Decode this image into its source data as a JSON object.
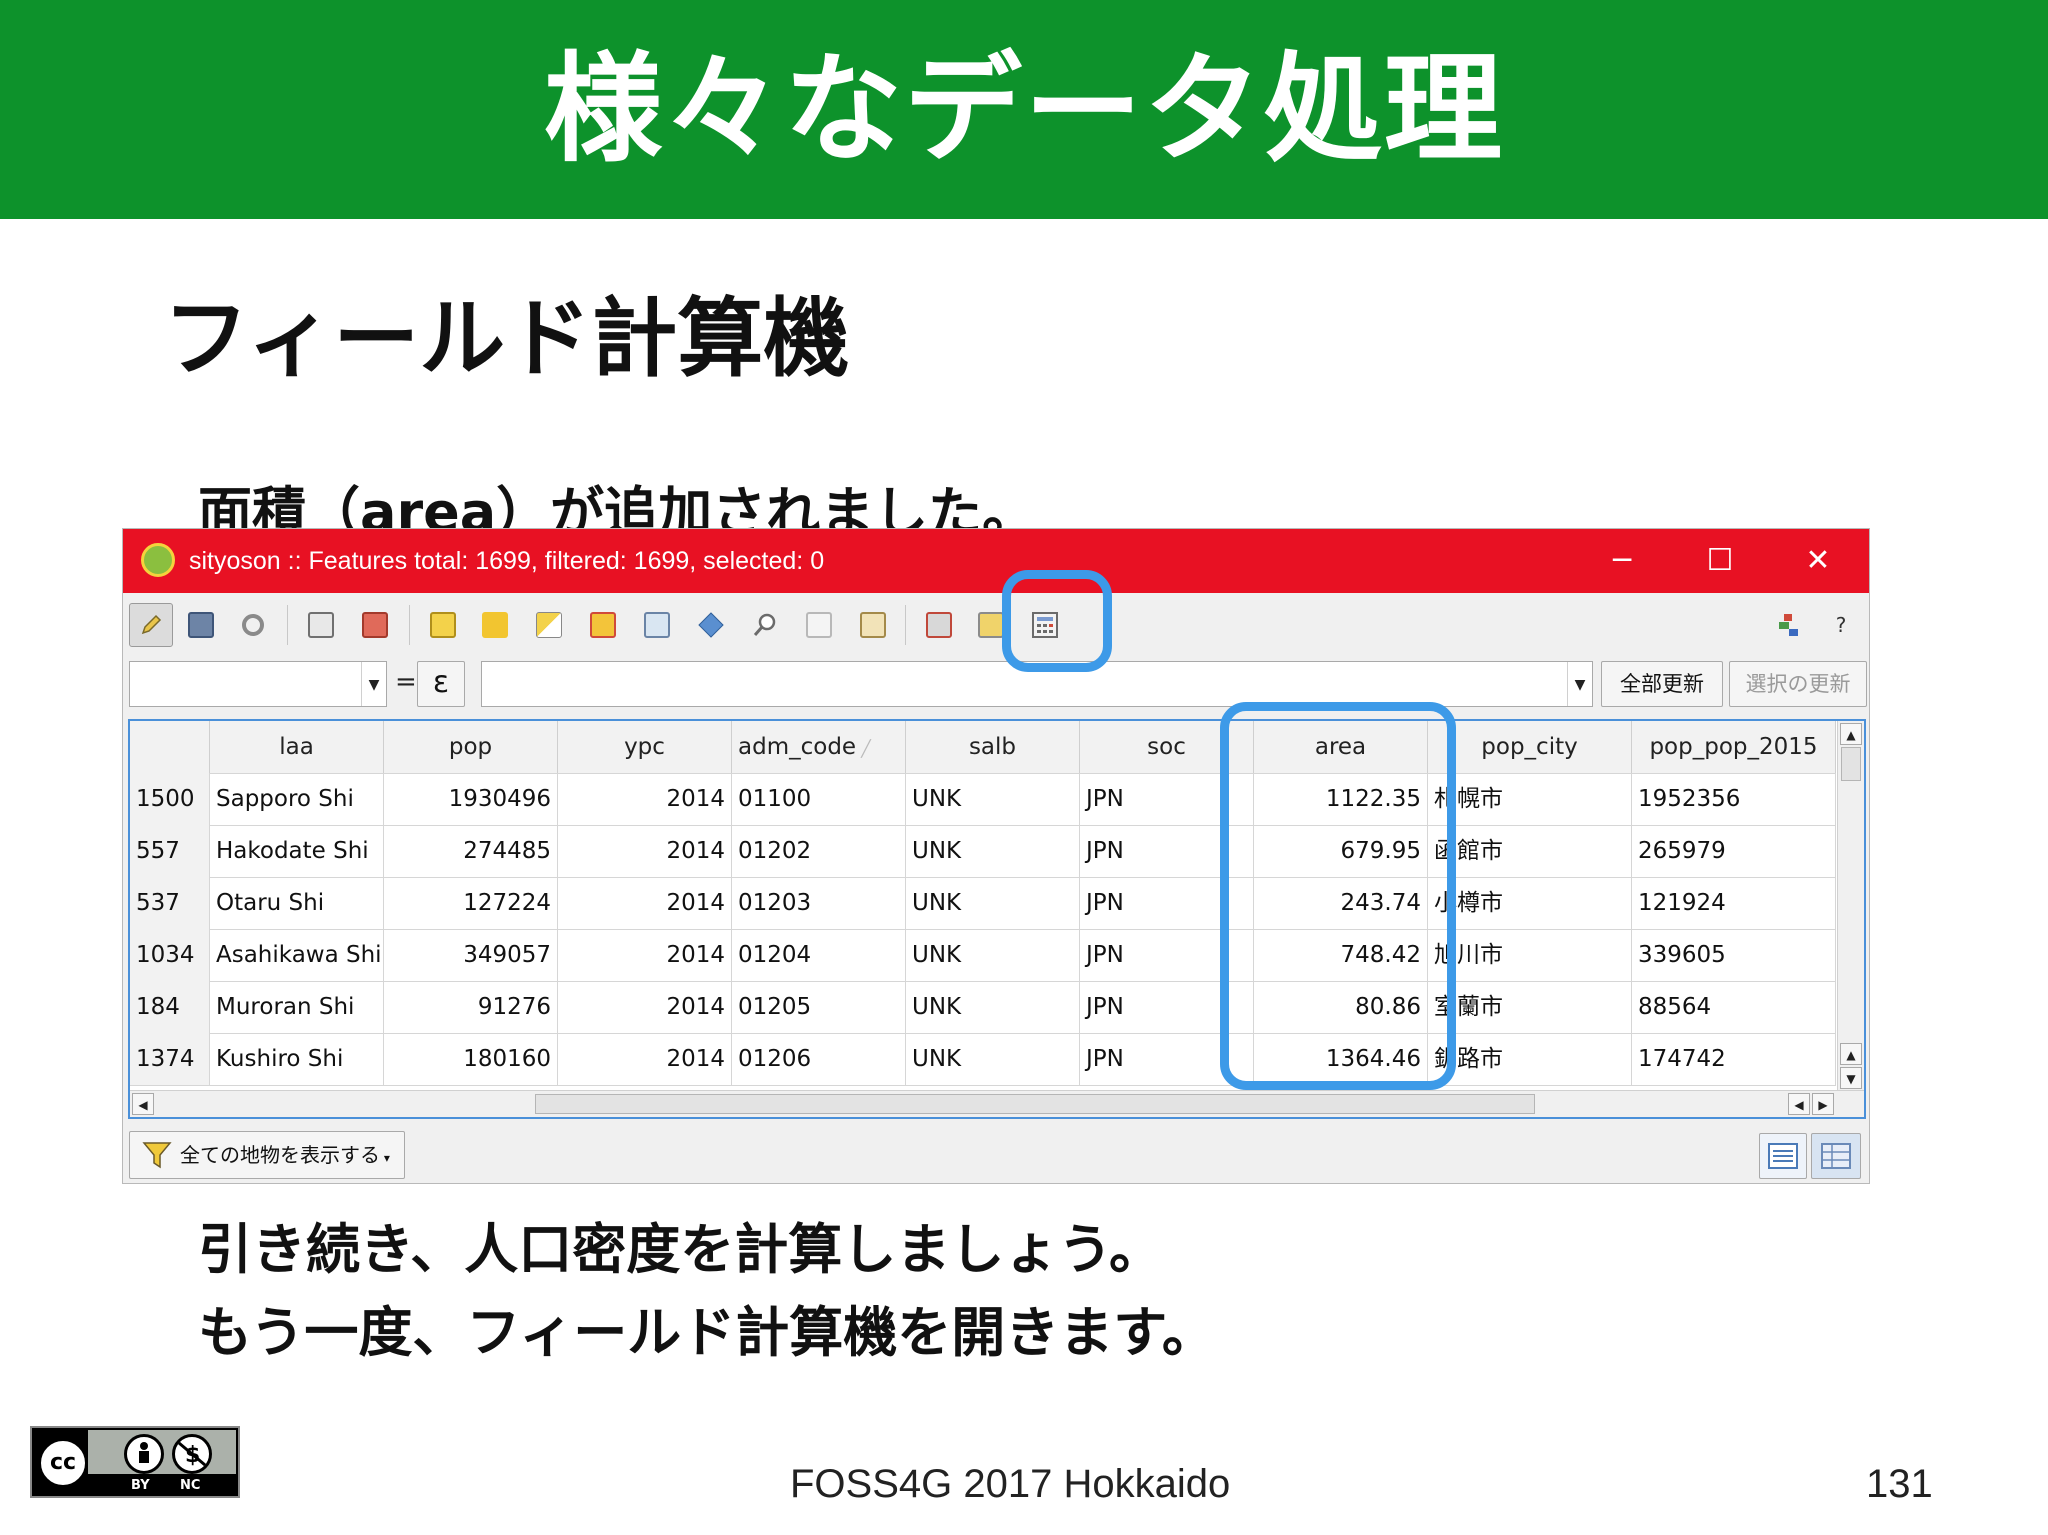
{
  "slide": {
    "title": "様々なデータ処理",
    "subtitle": "フィールド計算機",
    "caption": "面積（area）が追加されました。",
    "body_lines": [
      "引き続き、人口密度を計算しましょう。",
      "もう一度、フィールド計算機を開きます。"
    ],
    "footer_center": "FOSS4G 2017 Hokkaido",
    "page_number": "131",
    "license": {
      "cc": "cc",
      "by": "BY",
      "nc": "NC"
    },
    "colors": {
      "header_bg": "#0d922b",
      "highlight": "#3d9ae8",
      "titlebar": "#e81123"
    }
  },
  "window": {
    "title": "sityoson :: Features total: 1699, filtered: 1699, selected: 0",
    "controls": {
      "minimize": "─",
      "maximize": "☐",
      "close": "✕"
    },
    "toolbar_icons": [
      "pencil-icon",
      "save-icon",
      "reload-icon",
      "add-feature-icon",
      "delete-icon",
      "expression-select-icon",
      "select-all-icon",
      "invert-selection-icon",
      "deselect-icon",
      "move-selection-top-icon",
      "pan-to-selection-icon",
      "zoom-to-selection-icon",
      "copy-icon",
      "paste-icon",
      "delete-field-icon",
      "new-field-icon",
      "field-calculator-icon",
      "dock-icon",
      "help-icon"
    ],
    "help_label": "?",
    "expression_bar": {
      "field_combo_value": "",
      "equals": "=",
      "epsilon": "ε",
      "expression_value": "",
      "update_all": "全部更新",
      "update_selected": "選択の更新"
    },
    "table": {
      "columns": [
        "",
        "laa",
        "pop",
        "ypc",
        "adm_code",
        "salb",
        "soc",
        "area",
        "pop_city",
        "pop_pop_2015"
      ],
      "rows": [
        [
          "1500",
          "Sapporo Shi",
          "1930496",
          "2014",
          "01100",
          "UNK",
          "JPN",
          "1122.35",
          "札幌市",
          "1952356"
        ],
        [
          "557",
          "Hakodate Shi",
          "274485",
          "2014",
          "01202",
          "UNK",
          "JPN",
          "679.95",
          "函館市",
          "265979"
        ],
        [
          "537",
          "Otaru Shi",
          "127224",
          "2014",
          "01203",
          "UNK",
          "JPN",
          "243.74",
          "小樽市",
          "121924"
        ],
        [
          "1034",
          "Asahikawa Shi",
          "349057",
          "2014",
          "01204",
          "UNK",
          "JPN",
          "748.42",
          "旭川市",
          "339605"
        ],
        [
          "184",
          "Muroran Shi",
          "91276",
          "2014",
          "01205",
          "UNK",
          "JPN",
          "80.86",
          "室蘭市",
          "88564"
        ],
        [
          "1374",
          "Kushiro Shi",
          "180160",
          "2014",
          "01206",
          "UNK",
          "JPN",
          "1364.46",
          "釧路市",
          "174742"
        ]
      ]
    },
    "filter_button": "全ての地物を表示する"
  }
}
